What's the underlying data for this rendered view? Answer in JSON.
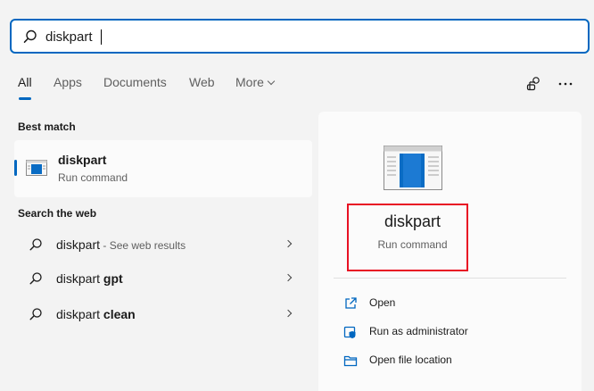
{
  "search": {
    "value": "diskpart",
    "placeholder": ""
  },
  "tabs": [
    {
      "label": "All"
    },
    {
      "label": "Apps"
    },
    {
      "label": "Documents"
    },
    {
      "label": "Web"
    },
    {
      "label": "More"
    }
  ],
  "sections": {
    "best_match": "Best match",
    "search_web": "Search the web"
  },
  "best_match": {
    "title": "diskpart",
    "subtitle": "Run command"
  },
  "web_results": [
    {
      "prefix": "diskpart",
      "bold": "",
      "hint": " - See web results"
    },
    {
      "prefix": "diskpart ",
      "bold": "gpt",
      "hint": ""
    },
    {
      "prefix": "diskpart ",
      "bold": "clean",
      "hint": ""
    }
  ],
  "detail": {
    "title": "diskpart",
    "subtitle": "Run command",
    "actions": [
      {
        "label": "Open",
        "icon": "open-icon"
      },
      {
        "label": "Run as administrator",
        "icon": "shield-icon"
      },
      {
        "label": "Open file location",
        "icon": "folder-icon"
      }
    ]
  },
  "colors": {
    "accent": "#0067c0",
    "highlight": "#e81123",
    "background": "#f3f3f3",
    "panel": "#fbfbfb"
  }
}
